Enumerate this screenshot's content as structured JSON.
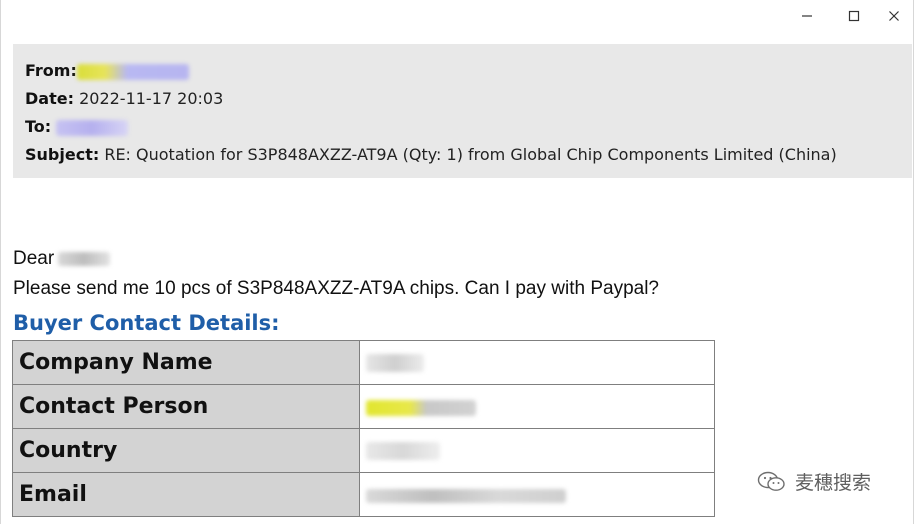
{
  "window": {
    "controls": {
      "minimize_icon": "minimize-icon",
      "maximize_icon": "maximize-icon",
      "close_icon": "close-icon"
    }
  },
  "header": {
    "from_label": "From:",
    "date_label": "Date:",
    "date_value": "2022-11-17 20:03",
    "to_label": "To:",
    "subject_label": "Subject:",
    "subject_value": "RE: Quotation for S3P848AXZZ-AT9A (Qty: 1) from Global Chip Components Limited (China)"
  },
  "body": {
    "greeting": "Dear",
    "message": "Please send me 10 pcs of S3P848AXZZ-AT9A chips. Can I pay with Paypal?",
    "section_title": "Buyer Contact Details:"
  },
  "contact_table": {
    "rows": [
      {
        "label": "Company Name"
      },
      {
        "label": "Contact Person"
      },
      {
        "label": "Country"
      },
      {
        "label": "Email"
      }
    ]
  },
  "watermark": {
    "text": "麦穗搜索",
    "icon": "wechat-icon"
  },
  "colors": {
    "header_bg": "#e8e8e8",
    "section_title": "#1f5ea8",
    "table_label_bg": "#d3d3d3"
  }
}
